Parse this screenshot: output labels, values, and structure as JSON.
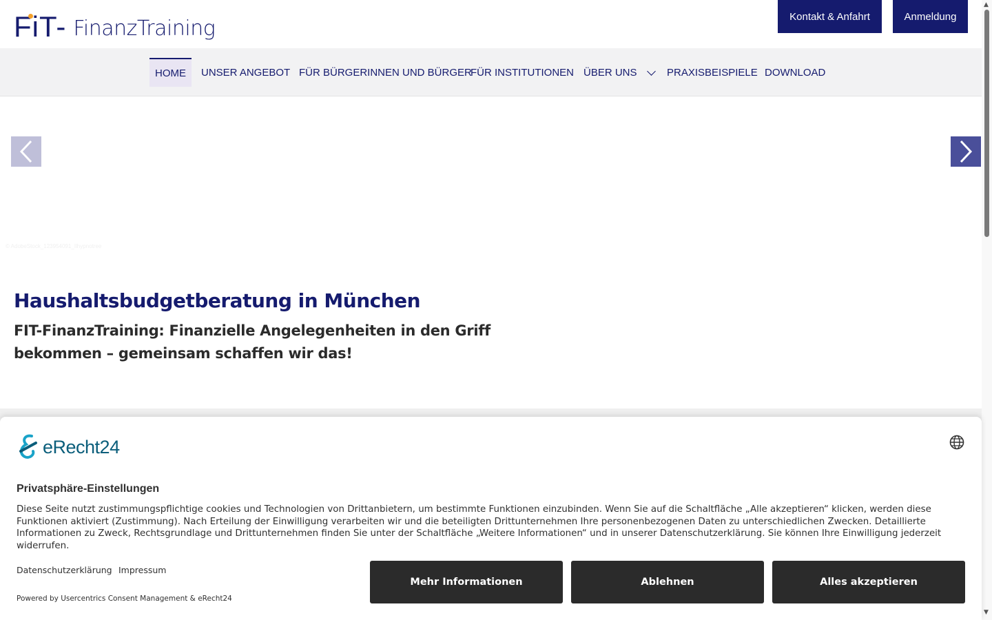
{
  "header": {
    "logo": {
      "brand": "FiT-",
      "name": "FinanzTraining"
    },
    "buttons": {
      "contact": "Kontakt & Anfahrt",
      "login": "Anmeldung"
    }
  },
  "nav": {
    "items": [
      {
        "label": "HOME",
        "active": true
      },
      {
        "label": "UNSER ANGEBOT"
      },
      {
        "label": "FÜR BÜRGERINNEN UND BÜRGER"
      },
      {
        "label": "FÜR INSTITUTIONEN"
      },
      {
        "label": "ÜBER UNS",
        "has_dropdown": true
      },
      {
        "label": "PRAXISBEISPIELE"
      },
      {
        "label": "DOWNLOAD"
      }
    ]
  },
  "hero": {
    "credit": "© AdobeStock_123954091_Ilhypnotree",
    "title": "Haushaltsbudgetberatung in München",
    "subtitle": "FIT-FinanzTraining: Finanzielle Angelegenheiten in den Griff bekommen – gemeinsam schaffen wir das!"
  },
  "consent": {
    "logo_text": "eRecht24",
    "title": "Privatsphäre-Einstellungen",
    "text": "Diese Seite nutzt zustimmungspflichtige cookies und Technologien von Drittanbietern, um bestimmte Funktionen einzubinden. Wenn Sie auf die Schaltfläche „Alle akzeptieren“ klicken, werden diese Funktionen aktiviert (Zustimmung). Nach Erteilung der Einwilligung verarbeiten wir und die beteiligten Drittunternehmen Ihre personenbezogenen Daten zu unterschiedlichen Zwecken. Detaillierte Informationen zu Zweck, Rechtsgrundlage und Drittunternehmen finden Sie unter der Schaltfläche „Weitere Informationen“ und in unserer Datenschutzerklärung. Sie können Ihre Einwilligung jederzeit widerrufen.",
    "links": {
      "privacy": "Datenschutzerklärung",
      "imprint": "Impressum"
    },
    "powered": "Powered by Usercentrics Consent Management & eRecht24",
    "buttons": {
      "more": "Mehr Informationen",
      "deny": "Ablehnen",
      "accept": "Alles akzeptieren"
    }
  },
  "colors": {
    "brand": "#151b6e",
    "accent": "#f4a12b",
    "consent_button": "#2b2b2b",
    "erecht": "#0b5e7b"
  }
}
